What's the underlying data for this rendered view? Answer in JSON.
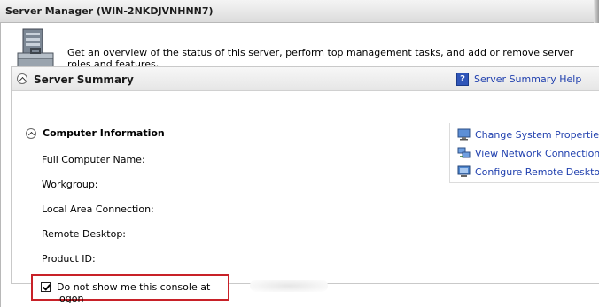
{
  "window": {
    "title": "Server Manager (WIN-2NKDJVNHNN7)"
  },
  "overview": {
    "icon": "server-toolbox-icon",
    "text": "Get an overview of the status of this server, perform top management tasks, and add or remove server roles and features."
  },
  "server_summary": {
    "title": "Server Summary",
    "help_icon": "help-book-icon",
    "help_link": "Server Summary Help"
  },
  "computer_information": {
    "title": "Computer Information",
    "fields": [
      {
        "label": "Full Computer Name:"
      },
      {
        "label": "Workgroup:"
      },
      {
        "label": "Local Area Connection:"
      },
      {
        "label": "Remote Desktop:"
      },
      {
        "label": "Product ID:"
      }
    ],
    "tasks": [
      {
        "label": "Change System Properties",
        "icon": "system-properties-icon"
      },
      {
        "label": "View Network Connections",
        "icon": "network-connections-icon"
      },
      {
        "label": "Configure Remote Desktop",
        "icon": "remote-desktop-icon"
      }
    ]
  },
  "logon_option": {
    "label": "Do not show me this console at logon",
    "checked": true
  },
  "colors": {
    "link": "#1f3fae",
    "highlight_border": "#c82128"
  }
}
